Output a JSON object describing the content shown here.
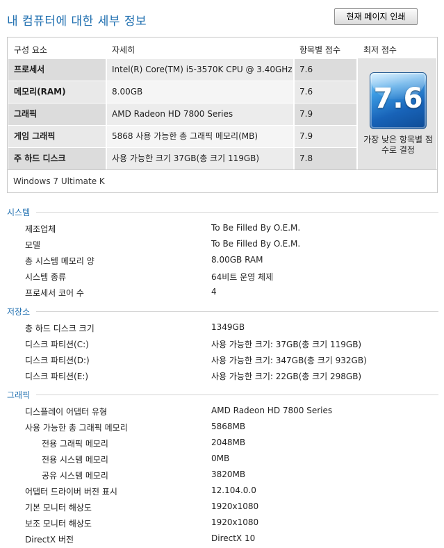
{
  "header": {
    "title": "내 컴퓨터에 대한 세부 정보",
    "print_button": "현재 페이지 인쇄"
  },
  "score_table": {
    "columns": [
      "구성 요소",
      "자세히",
      "항목별 점수",
      "최저 점수"
    ],
    "rows": [
      {
        "component": "프로세서",
        "detail": "Intel(R) Core(TM) i5-3570K CPU @ 3.40GHz",
        "score": "7.6"
      },
      {
        "component": "메모리(RAM)",
        "detail": "8.00GB",
        "score": "7.6"
      },
      {
        "component": "그래픽",
        "detail": "AMD Radeon HD 7800 Series",
        "score": "7.9"
      },
      {
        "component": "게임 그래픽",
        "detail": "5868 사용 가능한 총 그래픽 메모리(MB)",
        "score": "7.9"
      },
      {
        "component": "주 하드 디스크",
        "detail": "사용 가능한 크기 37GB(총 크기 119GB)",
        "score": "7.8"
      }
    ],
    "base_score": "7.6",
    "base_score_note": "가장 낮은 항목별 점수로 결정",
    "os_edition": "Windows 7 Ultimate K"
  },
  "system": {
    "heading": "시스템",
    "items": [
      {
        "label": "제조업체",
        "value": "To Be Filled By O.E.M."
      },
      {
        "label": "모델",
        "value": "To Be Filled By O.E.M."
      },
      {
        "label": "총 시스템 메모리 양",
        "value": "8.00GB RAM"
      },
      {
        "label": "시스템 종류",
        "value": "64비트 운영 체제"
      },
      {
        "label": "프로세서 코어 수",
        "value": "4"
      }
    ]
  },
  "storage": {
    "heading": "저장소",
    "items": [
      {
        "label": "총 하드 디스크 크기",
        "value": "1349GB"
      },
      {
        "label": "디스크 파티션(C:)",
        "value": "사용 가능한 크기: 37GB(총 크기 119GB)"
      },
      {
        "label": "디스크 파티션(D:)",
        "value": "사용 가능한 크기: 347GB(총 크기 932GB)"
      },
      {
        "label": "디스크 파티션(E:)",
        "value": "사용 가능한 크기: 22GB(총 크기 298GB)"
      }
    ]
  },
  "graphics": {
    "heading": "그래픽",
    "items": [
      {
        "label": "디스플레이 어댑터 유형",
        "value": "AMD Radeon HD 7800 Series"
      },
      {
        "label": "사용 가능한 총 그래픽 메모리",
        "value": "5868MB"
      },
      {
        "label": "전용 그래픽 메모리",
        "value": "2048MB"
      },
      {
        "label": "전용 시스템 메모리",
        "value": "0MB"
      },
      {
        "label": "공유 시스템 메모리",
        "value": "3820MB"
      },
      {
        "label": "어댑터 드라이버 버전 표시",
        "value": "12.104.0.0"
      },
      {
        "label": "기본 모니터 해상도",
        "value": "1920x1080"
      },
      {
        "label": "보조 모니터 해상도",
        "value": "1920x1080"
      },
      {
        "label": "DirectX 버전",
        "value": "DirectX 10"
      }
    ]
  },
  "colors": {
    "title_blue": "#1f6fb0",
    "badge_blue": "#1863b8"
  }
}
